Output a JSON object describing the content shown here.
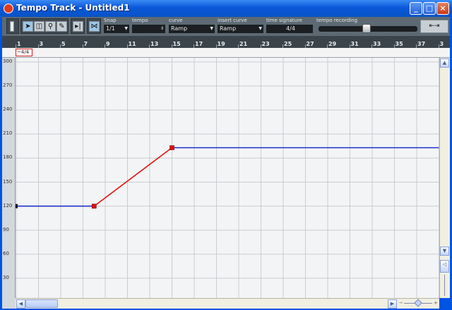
{
  "window": {
    "title": "Tempo Track - Untitled1"
  },
  "toolbar": {
    "tools": [
      "record-mode-icon",
      "arrow-icon",
      "draw-eraser-icon",
      "magnify-icon",
      "pencil-icon"
    ],
    "snap": {
      "label": "Snap",
      "value": "1/1"
    },
    "tempo": {
      "label": "tempo",
      "value": ""
    },
    "curve": {
      "label": "curve",
      "value": "Ramp"
    },
    "insert_curve": {
      "label": "insert curve",
      "value": "Ramp"
    },
    "time_signature": {
      "label": "time signature",
      "value": "4/4"
    },
    "tempo_recording": {
      "label": "tempo recording",
      "value": 0.55
    }
  },
  "ruler": {
    "bars": [
      "1",
      "3",
      "5",
      "7",
      "9",
      "11",
      "13",
      "15",
      "17",
      "19",
      "21",
      "23",
      "25",
      "27",
      "29",
      "31",
      "33",
      "35",
      "37",
      "3"
    ]
  },
  "signature_track": {
    "marker": "~4/4"
  },
  "chart_data": {
    "type": "line",
    "title": "",
    "xlabel": "",
    "ylabel": "",
    "xlim": [
      1,
      39
    ],
    "ylim": [
      0,
      300
    ],
    "yticks": [
      30,
      60,
      90,
      120,
      150,
      180,
      210,
      240,
      270,
      300
    ],
    "xticks": [
      1,
      3,
      5,
      7,
      9,
      11,
      13,
      15,
      17,
      19,
      21,
      23,
      25,
      27,
      29,
      31,
      33,
      35,
      37
    ],
    "grid": true,
    "series": [
      {
        "color": "#1f2fcc",
        "points": [
          [
            1,
            120
          ],
          [
            8,
            120
          ]
        ]
      },
      {
        "color": "#e01010",
        "points": [
          [
            8,
            120
          ],
          [
            15,
            193
          ]
        ]
      },
      {
        "color": "#1f2fcc",
        "points": [
          [
            15,
            193
          ],
          [
            39,
            193
          ]
        ]
      }
    ],
    "tempo_points": [
      [
        1,
        120
      ],
      [
        8,
        120
      ],
      [
        15,
        193
      ]
    ]
  },
  "colors": {
    "accent_blue": "#1f2fcc",
    "accent_red": "#e01010"
  }
}
